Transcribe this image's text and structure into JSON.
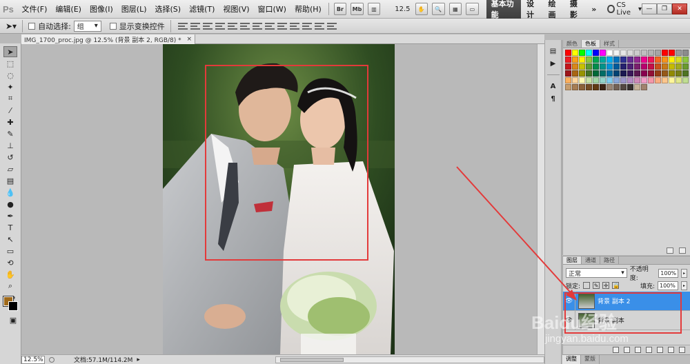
{
  "app": {
    "logo": "Ps"
  },
  "menu": [
    "文件(F)",
    "编辑(E)",
    "图像(I)",
    "图层(L)",
    "选择(S)",
    "滤镜(T)",
    "视图(V)",
    "窗口(W)",
    "帮助(H)"
  ],
  "menubar": {
    "bridge_label": "Br",
    "minibridge_label": "Mb",
    "zoom": "12.5",
    "workspaces": {
      "active": "基本功能",
      "items": [
        "设计",
        "绘画",
        "摄影"
      ],
      "more": "»"
    },
    "cslive": "CS Live"
  },
  "options": {
    "auto_select_label": "自动选择:",
    "auto_select_value": "组",
    "show_transform_label": "显示变换控件"
  },
  "document": {
    "tab_title": "IMG_1700_proc.jpg @ 12.5% (背景 副本 2, RGB/8) *",
    "tab_close": "×"
  },
  "status": {
    "zoom": "12.5%",
    "doc_info": "文档:57.1M/114.2M"
  },
  "swatches_panel": {
    "tabs": [
      "颜色",
      "色板",
      "样式"
    ],
    "active_tab": "色板",
    "colors": [
      "#ff0000",
      "#ffff00",
      "#00ff00",
      "#00ffff",
      "#0000ff",
      "#ff00ff",
      "#ffffff",
      "#f2f2f2",
      "#e6e6e6",
      "#d9d9d9",
      "#cccccc",
      "#bfbfbf",
      "#b3b3b3",
      "#a6a6a6",
      "#ff0000",
      "#ff0000",
      "#999999",
      "#8c8c8c",
      "#ee1c24",
      "#f9a11b",
      "#fef200",
      "#8cc63e",
      "#00a650",
      "#00a99d",
      "#00adee",
      "#0072bc",
      "#2e3192",
      "#662d91",
      "#92278f",
      "#ec008c",
      "#ed145b",
      "#f26522",
      "#f7941d",
      "#fff200",
      "#d7df23",
      "#8dc63f",
      "#c4161c",
      "#d8871b",
      "#c7c200",
      "#5c9a31",
      "#008d4c",
      "#00938a",
      "#0094d7",
      "#005b9a",
      "#26216e",
      "#4f2176",
      "#7a1f6d",
      "#b8006e",
      "#c51048",
      "#c9501c",
      "#c87a18",
      "#c5bb00",
      "#a2ab1e",
      "#6a9a30",
      "#9c1519",
      "#a86614",
      "#989400",
      "#437326",
      "#006938",
      "#006d66",
      "#006ea0",
      "#004373",
      "#1b1851",
      "#3a1859",
      "#5a1750",
      "#88004f",
      "#921037",
      "#943d16",
      "#95591a",
      "#928b00",
      "#777f16",
      "#4f7324",
      "#fbaf5d",
      "#fdd59e",
      "#fff9b1",
      "#c5e0a5",
      "#a2d4a6",
      "#95d3cb",
      "#7fcdf0",
      "#8ba8d8",
      "#9d96c9",
      "#b38cc2",
      "#cf8ab8",
      "#f19ec7",
      "#f497a9",
      "#f9ad81",
      "#fbc68d",
      "#fff79a",
      "#e1e88d",
      "#bfdd92",
      "#c69c6d",
      "#a67c52",
      "#8c6239",
      "#754c24",
      "#603913",
      "#3c2415",
      "#998675",
      "#736357",
      "#534741",
      "#362f2d",
      "#c7b299",
      "#a1826e"
    ]
  },
  "layers_panel": {
    "tabs": [
      "图层",
      "通道",
      "路径"
    ],
    "active_tab": "图层",
    "blend_mode": "正常",
    "opacity_label": "不透明度:",
    "opacity": "100%",
    "lock_label": "锁定:",
    "fill_label": "填充:",
    "fill": "100%",
    "layers": [
      {
        "name": "背景 副本 2",
        "selected": true
      },
      {
        "name": "背景 副本",
        "selected": false
      }
    ]
  },
  "bottom_tabs": [
    "调整",
    "蒙版"
  ],
  "watermark": {
    "main": "Baidu经验",
    "sub": "jingyan.baidu.com"
  }
}
